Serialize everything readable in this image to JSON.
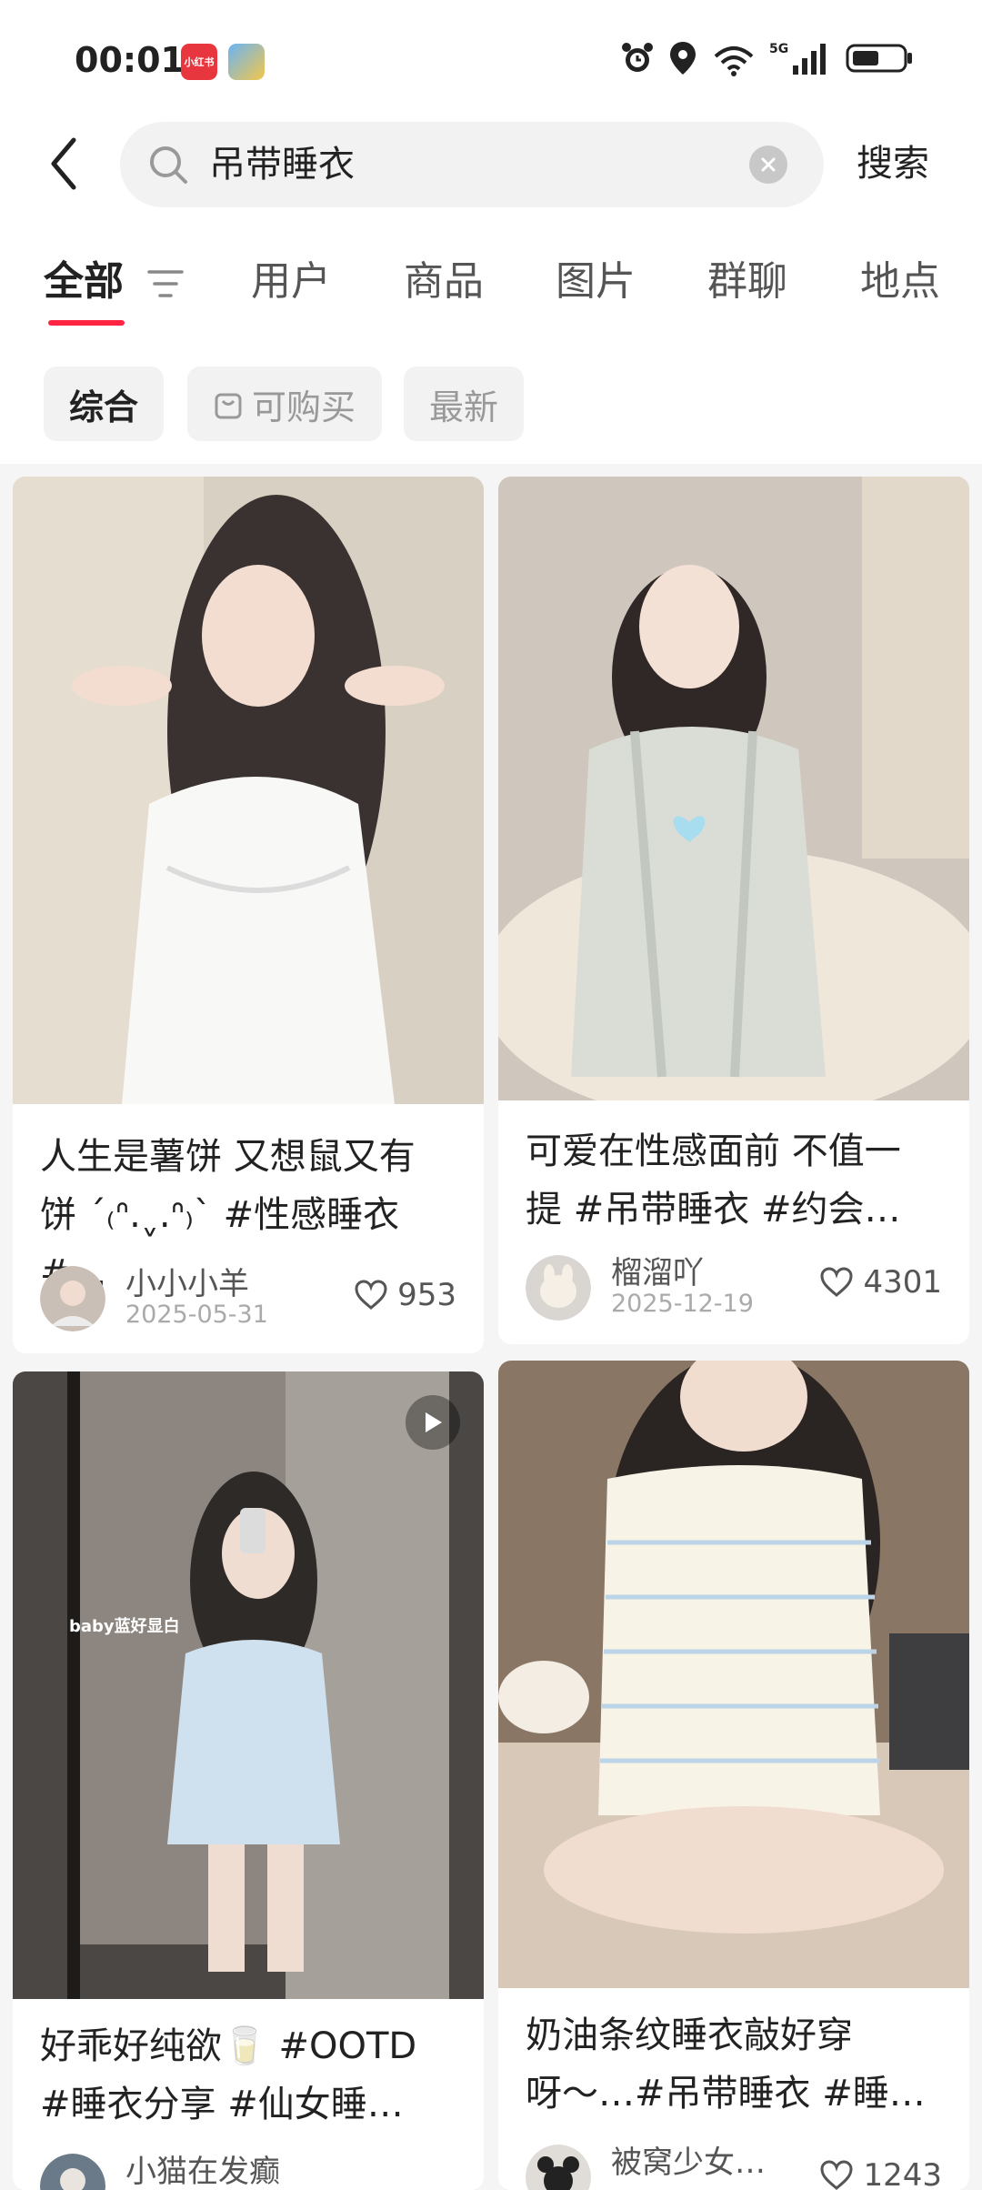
{
  "status_bar": {
    "time": "00:01",
    "app_badge_1": "小红书",
    "network": "5G"
  },
  "search": {
    "query": "吊带睡衣",
    "submit_label": "搜索"
  },
  "tabs": [
    "全部",
    "用户",
    "商品",
    "图片",
    "群聊",
    "地点"
  ],
  "filters": [
    "综合",
    "可购买",
    "最新"
  ],
  "colors": {
    "accent": "#ff2442",
    "chip_bg": "#f2f2f2",
    "page_bg": "#f5f5f5"
  },
  "feed": [
    {
      "title_line1": "人生是薯饼 又想鼠又有",
      "title_line2": "饼 ˊ₍ᐢ.ˬ.ᐢ₎ˋ #性感睡衣 #…",
      "author": "小小小羊",
      "date": "2025-05-31",
      "likes": "953",
      "image": "photo-white-slip-dress"
    },
    {
      "title_line1": "可爱在性感面前 不值一",
      "title_line2": "提 #吊带睡衣 #约会…",
      "author": "榴溜吖",
      "date": "2025-12-19",
      "likes": "4301",
      "image": "photo-grey-lace-robe"
    },
    {
      "title_line1": "好乖好纯欲🥛 #OOTD",
      "title_line2": "#睡衣分享 #仙女睡…",
      "author": "小猫在发癫",
      "overlay": "baby蓝好显白",
      "image": "photo-blue-mirror-selfie",
      "is_video": true
    },
    {
      "title_line1": "奶油条纹睡衣敲好穿",
      "title_line2": "呀～…#吊带睡衣 #睡…",
      "author": "被窝少女…",
      "likes": "1243",
      "image": "photo-striped-pajamas"
    }
  ]
}
